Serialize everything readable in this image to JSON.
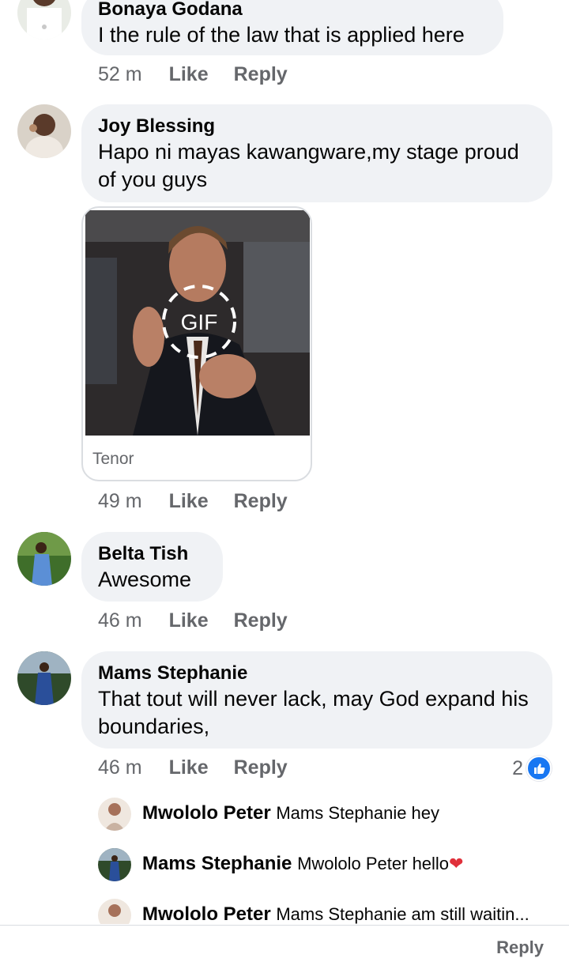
{
  "comments": [
    {
      "author": "Bonaya Godana",
      "text": "I the rule of the law that is applied here",
      "time": "52 m",
      "like": "Like",
      "reply": "Reply"
    },
    {
      "author": "Joy Blessing",
      "text": "Hapo ni mayas kawangware,my stage proud of you guys",
      "time": "49 m",
      "like": "Like",
      "reply": "Reply",
      "gif_badge": "GIF",
      "gif_source": "Tenor"
    },
    {
      "author": "Belta Tish",
      "text": "Awesome",
      "time": "46 m",
      "like": "Like",
      "reply": "Reply"
    },
    {
      "author": "Mams Stephanie",
      "text": "That tout will never lack, may God expand his boundaries,",
      "time": "46 m",
      "like": "Like",
      "reply": "Reply",
      "reaction_count": "2",
      "reaction_icon": "thumbs-up-icon"
    }
  ],
  "replies": [
    {
      "author": "Mwololo Peter",
      "text": "Mams Stephanie hey"
    },
    {
      "author": "Mams Stephanie",
      "text": "Mwololo Peter hello",
      "emoji": "❤"
    },
    {
      "author": "Mwololo Peter",
      "text": "Mams Stephanie am still waitin..."
    }
  ],
  "footer": {
    "partial_label": "Reply"
  },
  "colors": {
    "bubble": "#f0f2f5",
    "meta": "#65676b",
    "like_blue": "#1877f2"
  }
}
